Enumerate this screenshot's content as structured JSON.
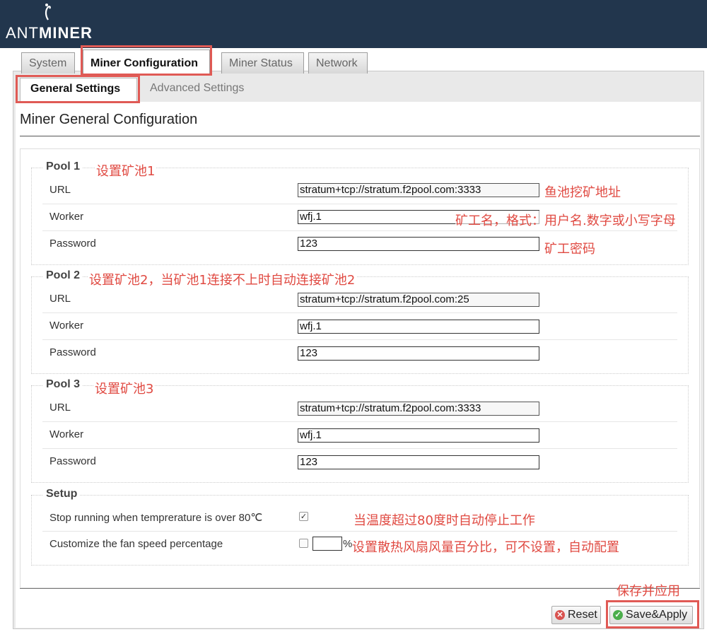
{
  "header": {
    "logo_prefix": "ANT",
    "logo_suffix": "MINER"
  },
  "tabs": [
    "System",
    "Miner Configuration",
    "Miner Status",
    "Network"
  ],
  "subtabs": [
    "General Settings",
    "Advanced Settings"
  ],
  "page_title": "Miner General Configuration",
  "labels": {
    "url": "URL",
    "worker": "Worker",
    "password": "Password"
  },
  "pools": [
    {
      "legend": "Pool 1",
      "url": "stratum+tcp://stratum.f2pool.com:3333",
      "worker": "wfj.1",
      "password": "123"
    },
    {
      "legend": "Pool 2",
      "url": "stratum+tcp://stratum.f2pool.com:25",
      "worker": "wfj.1",
      "password": "123"
    },
    {
      "legend": "Pool 3",
      "url": "stratum+tcp://stratum.f2pool.com:3333",
      "worker": "wfj.1",
      "password": "123"
    }
  ],
  "setup": {
    "legend": "Setup",
    "temp_label": "Stop running when temprerature is over 80℃",
    "temp_checked": true,
    "fan_label": "Customize the fan speed percentage",
    "fan_checked": false,
    "fan_value": "",
    "fan_unit": "%"
  },
  "buttons": {
    "reset": "Reset",
    "save": "Save&Apply"
  },
  "annotations": {
    "pool1": "设置矿池1",
    "url": "鱼池挖矿地址",
    "worker": "矿工名，格式：用户名.数字或小写字母",
    "password": "矿工密码",
    "pool2": "设置矿池2，当矿池1连接不上时自动连接矿池2",
    "pool3": "设置矿池3",
    "temp": "当温度超过80度时自动停止工作",
    "fan": "设置散热风扇风量百分比，可不设置，自动配置",
    "save": "保存并应用"
  },
  "colors": {
    "header": "#22364d",
    "annotation": "#e04a42"
  }
}
